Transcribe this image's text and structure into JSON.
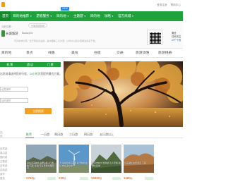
{
  "colors": {
    "brand_green": "#1fa23c",
    "accent_orange": "#f2a01f",
    "price_orange": "#f47920",
    "link_blue": "#1e88e5"
  },
  "topnav": {
    "items": [
      {
        "label": "首页",
        "active": true
      },
      {
        "label": "目的地推荐",
        "caret": true
      },
      {
        "label": "游客服务",
        "caret": true
      },
      {
        "label": "目的地",
        "caret": true
      },
      {
        "label": "主题游",
        "caret": true
      },
      {
        "label": "目的地"
      },
      {
        "label": "攻略",
        "caret": true
      },
      {
        "label": "官方商城",
        "caret": true
      }
    ],
    "hot_badge": "NEW",
    "right_links": [
      "登录注册",
      "帮助中心"
    ]
  },
  "destination": {
    "sub_label": "当前位置：",
    "breadcrumb": "长城旅游官网",
    "name": "长城旅游",
    "tag": "Badanjilin",
    "desc": "巴丹吉林沙漠，位于阿拉善右旗，是中国第三大沙漠，以鸣沙山和沙漠湖泊闻名于世。",
    "app_title": "微信",
    "app_subtitle": "扫码关注",
    "app_link": "APP下载"
  },
  "subnav": {
    "items": [
      "目的地",
      "景点",
      "线路",
      "美食",
      "住宿",
      "交通",
      "旅游攻略",
      "旅游相册"
    ]
  },
  "booking": {
    "tabs": [
      "机",
      "票",
      "酒",
      "店",
      "门",
      "票"
    ],
    "prompt_prefix": "出发前请选择您的行程，",
    "prompt_highlight": "24小时",
    "prompt_suffix": "为您提供最优方案。",
    "from_placeholder": "出发城市",
    "to_placeholder": "目的城市",
    "search_label": "立即搜索"
  },
  "bottom": {
    "side_label": "品质",
    "tabs": [
      "推荐",
      "一日游",
      "两日游",
      "三日游",
      "四日游",
      "五日游以上"
    ],
    "left_labels": [
      "出境游",
      "周边游",
      "国内游",
      "主题游",
      "自驾游",
      "定制游",
      "游学",
      "更多"
    ]
  },
  "cards": [
    {
      "caption": "阿拉善英雄会 越野e族 2日游 含门票+住宿 专业导游全程陪同",
      "price": "750",
      "unit": "起"
    },
    {
      "caption": "大漠胡杨林深度游 额济纳旗金秋 含往返交通",
      "price": "30",
      "unit": "起"
    },
    {
      "caption": "巴丹吉林沙漠穿越 双人套餐 越野车接送",
      "price": "5980",
      "unit": "起"
    },
    {
      "caption": "月亮湖生态旅游区 门票",
      "price": "480",
      "unit": "起"
    }
  ]
}
